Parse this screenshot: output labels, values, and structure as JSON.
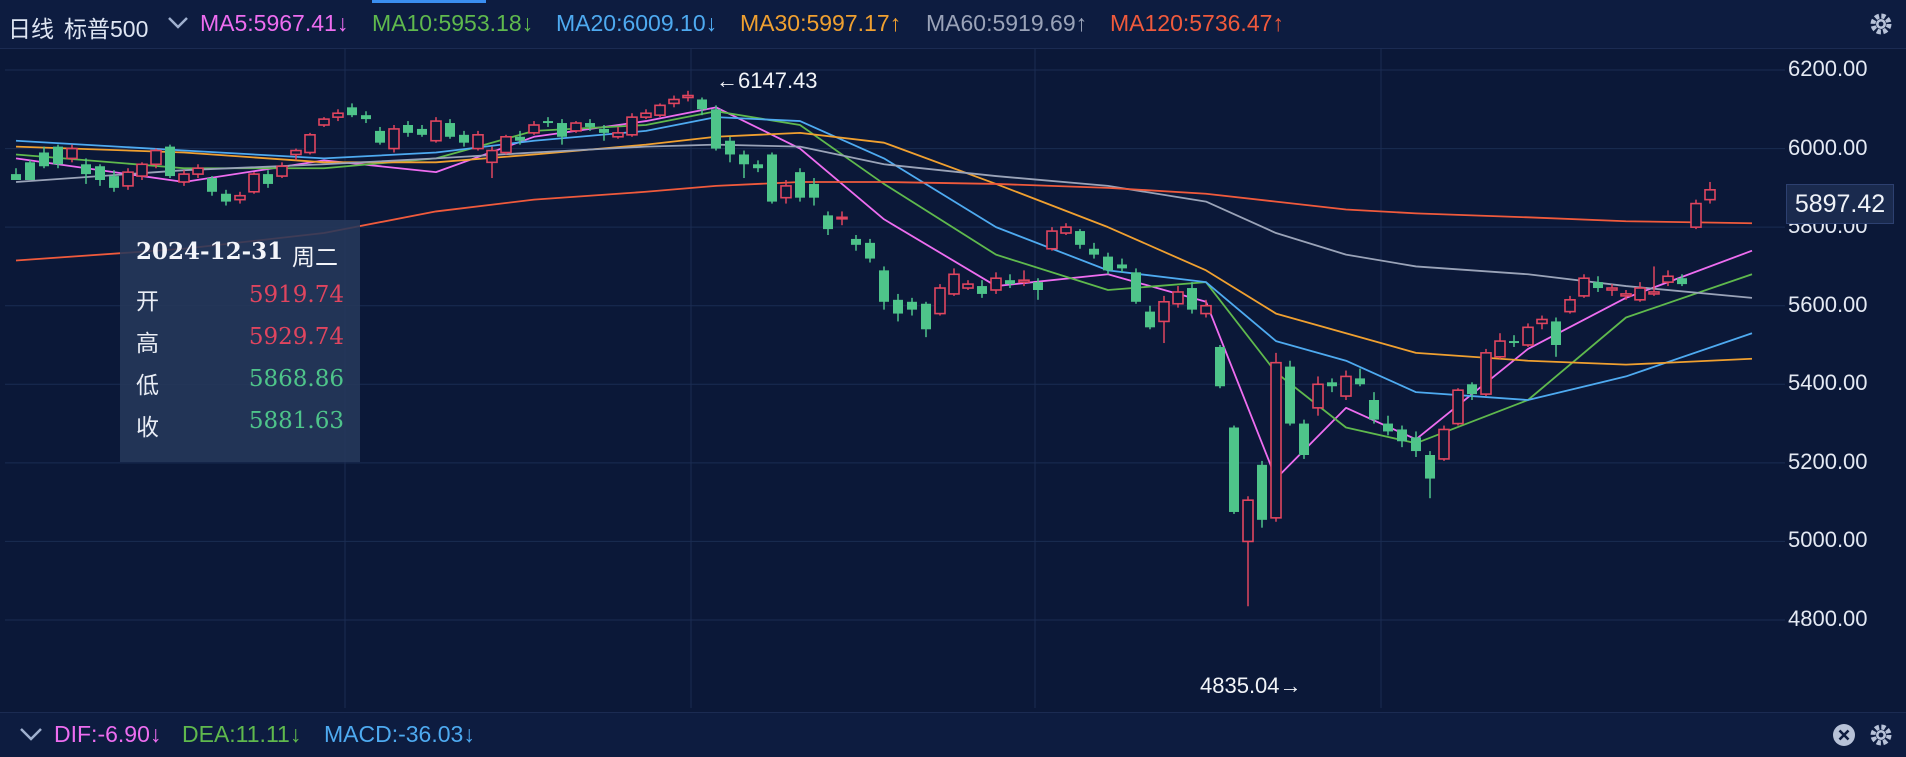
{
  "header": {
    "period": "日线",
    "symbol": "标普500",
    "ma_labels": [
      {
        "text": "MA5:5967.41",
        "arrow": "↓",
        "color": "#ee6df0"
      },
      {
        "text": "MA10:5953.18",
        "arrow": "↓",
        "color": "#5fb94d"
      },
      {
        "text": "MA20:6009.10",
        "arrow": "↓",
        "color": "#4eaaf0"
      },
      {
        "text": "MA30:5997.17",
        "arrow": "↑",
        "color": "#f0a030"
      },
      {
        "text": "MA60:5919.69",
        "arrow": "↑",
        "color": "#9aa3b8"
      },
      {
        "text": "MA120:5736.47",
        "arrow": "↑",
        "color": "#f05a3c"
      }
    ]
  },
  "tooltip": {
    "date": "2024-12-31",
    "weekday": "周二",
    "rows": [
      {
        "label": "开",
        "value": "5919.74",
        "color": "#e0455f"
      },
      {
        "label": "高",
        "value": "5929.74",
        "color": "#e0455f"
      },
      {
        "label": "低",
        "value": "5868.86",
        "color": "#4ec48a"
      },
      {
        "label": "收",
        "value": "5881.63",
        "color": "#4ec48a"
      }
    ]
  },
  "annotations": {
    "high": "←6147.43",
    "low": "4835.04→"
  },
  "current_price": "5897.42",
  "footer": {
    "macd": [
      {
        "text": "DIF:-6.90",
        "arrow": "↓",
        "color": "#ee6df0"
      },
      {
        "text": "DEA:11.11",
        "arrow": "↓",
        "color": "#5fb94d"
      },
      {
        "text": "MACD:-36.03",
        "arrow": "↓",
        "color": "#4eaaf0"
      }
    ]
  },
  "colors": {
    "up": "#e0455f",
    "down": "#4ec48a",
    "grid": "#1b2c52"
  },
  "chart_data": {
    "type": "candlestick",
    "y_ticks": [
      "6200.00",
      "6000.00",
      "5800.00",
      "5600.00",
      "5400.00",
      "5200.00",
      "5000.00",
      "4800.00"
    ],
    "ylim": [
      4780,
      6230
    ],
    "candles": [
      [
        5935,
        5920,
        5950,
        5925
      ],
      [
        5965,
        5920,
        5970,
        5940
      ],
      [
        5990,
        5955,
        6005,
        5950
      ],
      [
        6005,
        5960,
        6010,
        5950
      ],
      [
        5975,
        6000,
        6010,
        5965
      ],
      [
        5960,
        5935,
        5975,
        5910
      ],
      [
        5955,
        5920,
        5960,
        5905
      ],
      [
        5930,
        5900,
        5945,
        5890
      ],
      [
        5905,
        5940,
        5950,
        5895
      ],
      [
        5930,
        5960,
        5965,
        5920
      ],
      [
        5960,
        5995,
        6000,
        5950
      ],
      [
        6005,
        5930,
        6010,
        5925
      ],
      [
        5915,
        5935,
        5945,
        5905
      ],
      [
        5935,
        5950,
        5960,
        5925
      ],
      [
        5925,
        5890,
        5930,
        5880
      ],
      [
        5885,
        5865,
        5895,
        5855
      ],
      [
        5870,
        5880,
        5890,
        5860
      ],
      [
        5890,
        5935,
        5940,
        5885
      ],
      [
        5935,
        5910,
        5945,
        5900
      ],
      [
        5930,
        5955,
        5965,
        5925
      ],
      [
        5985,
        5995,
        6000,
        5970
      ],
      [
        5990,
        6035,
        6040,
        5985
      ],
      [
        6060,
        6075,
        6080,
        6055
      ],
      [
        6080,
        6090,
        6100,
        6070
      ],
      [
        6105,
        6085,
        6115,
        6080
      ],
      [
        6085,
        6075,
        6095,
        6065
      ],
      [
        6045,
        6015,
        6055,
        6010
      ],
      [
        6000,
        6050,
        6060,
        5990
      ],
      [
        6060,
        6040,
        6070,
        6030
      ],
      [
        6050,
        6035,
        6060,
        6030
      ],
      [
        6020,
        6070,
        6080,
        6015
      ],
      [
        6065,
        6030,
        6075,
        6025
      ],
      [
        6035,
        6015,
        6045,
        6005
      ],
      [
        6000,
        6035,
        6045,
        5995
      ],
      [
        5965,
        5995,
        6005,
        5925
      ],
      [
        5990,
        6030,
        6035,
        5985
      ],
      [
        6030,
        6020,
        6045,
        6010
      ],
      [
        6040,
        6060,
        6070,
        6035
      ],
      [
        6070,
        6065,
        6080,
        6055
      ],
      [
        6065,
        6030,
        6075,
        6010
      ],
      [
        6045,
        6065,
        6070,
        6040
      ],
      [
        6065,
        6055,
        6075,
        6045
      ],
      [
        6050,
        6040,
        6060,
        6020
      ],
      [
        6030,
        6040,
        6055,
        6025
      ],
      [
        6035,
        6080,
        6090,
        6030
      ],
      [
        6080,
        6090,
        6100,
        6075
      ],
      [
        6085,
        6110,
        6115,
        6080
      ],
      [
        6115,
        6125,
        6135,
        6105
      ],
      [
        6130,
        6135,
        6147,
        6120
      ],
      [
        6125,
        6100,
        6130,
        6085
      ],
      [
        6100,
        6000,
        6110,
        5995
      ],
      [
        6020,
        5985,
        6030,
        5965
      ],
      [
        5985,
        5960,
        5995,
        5925
      ],
      [
        5960,
        5950,
        5970,
        5940
      ],
      [
        5985,
        5865,
        5990,
        5860
      ],
      [
        5875,
        5905,
        5920,
        5860
      ],
      [
        5940,
        5875,
        5950,
        5865
      ],
      [
        5910,
        5875,
        5925,
        5855
      ],
      [
        5830,
        5795,
        5840,
        5780
      ],
      [
        5825,
        5825,
        5840,
        5805
      ],
      [
        5770,
        5755,
        5780,
        5740
      ],
      [
        5760,
        5720,
        5770,
        5710
      ],
      [
        5690,
        5610,
        5700,
        5590
      ],
      [
        5615,
        5580,
        5630,
        5560
      ],
      [
        5610,
        5590,
        5620,
        5575
      ],
      [
        5605,
        5540,
        5610,
        5520
      ],
      [
        5580,
        5645,
        5655,
        5575
      ],
      [
        5630,
        5680,
        5695,
        5625
      ],
      [
        5645,
        5655,
        5665,
        5640
      ],
      [
        5650,
        5630,
        5665,
        5620
      ],
      [
        5640,
        5670,
        5685,
        5630
      ],
      [
        5665,
        5655,
        5680,
        5645
      ],
      [
        5660,
        5665,
        5690,
        5650
      ],
      [
        5660,
        5640,
        5670,
        5615
      ],
      [
        5745,
        5790,
        5800,
        5740
      ],
      [
        5785,
        5800,
        5810,
        5780
      ],
      [
        5790,
        5755,
        5795,
        5745
      ],
      [
        5745,
        5730,
        5760,
        5720
      ],
      [
        5725,
        5690,
        5735,
        5680
      ],
      [
        5705,
        5695,
        5720,
        5685
      ],
      [
        5685,
        5610,
        5695,
        5605
      ],
      [
        5585,
        5545,
        5600,
        5540
      ],
      [
        5560,
        5610,
        5625,
        5505
      ],
      [
        5605,
        5635,
        5650,
        5595
      ],
      [
        5645,
        5590,
        5660,
        5580
      ],
      [
        5580,
        5600,
        5615,
        5570
      ],
      [
        5495,
        5395,
        5500,
        5390
      ],
      [
        5290,
        5075,
        5295,
        5070
      ],
      [
        5000,
        5105,
        5115,
        4835
      ],
      [
        5195,
        5055,
        5205,
        5035
      ],
      [
        5060,
        5455,
        5480,
        5050
      ],
      [
        5445,
        5300,
        5460,
        5295
      ],
      [
        5300,
        5220,
        5310,
        5210
      ],
      [
        5340,
        5400,
        5420,
        5320
      ],
      [
        5405,
        5395,
        5415,
        5380
      ],
      [
        5370,
        5420,
        5435,
        5360
      ],
      [
        5415,
        5400,
        5440,
        5395
      ],
      [
        5360,
        5310,
        5380,
        5300
      ],
      [
        5300,
        5280,
        5320,
        5270
      ],
      [
        5285,
        5255,
        5295,
        5240
      ],
      [
        5265,
        5230,
        5280,
        5215
      ],
      [
        5220,
        5160,
        5230,
        5110
      ],
      [
        5210,
        5285,
        5295,
        5205
      ],
      [
        5300,
        5385,
        5390,
        5295
      ],
      [
        5400,
        5375,
        5405,
        5360
      ],
      [
        5375,
        5480,
        5490,
        5370
      ],
      [
        5470,
        5510,
        5530,
        5465
      ],
      [
        5510,
        5505,
        5525,
        5495
      ],
      [
        5500,
        5545,
        5555,
        5495
      ],
      [
        5555,
        5565,
        5575,
        5540
      ],
      [
        5560,
        5500,
        5570,
        5470
      ],
      [
        5585,
        5615,
        5625,
        5580
      ],
      [
        5625,
        5670,
        5680,
        5620
      ],
      [
        5660,
        5645,
        5675,
        5635
      ],
      [
        5640,
        5645,
        5655,
        5625
      ],
      [
        5625,
        5630,
        5640,
        5615
      ],
      [
        5615,
        5645,
        5660,
        5610
      ],
      [
        5630,
        5635,
        5700,
        5625
      ],
      [
        5660,
        5675,
        5690,
        5650
      ],
      [
        5670,
        5655,
        5680,
        5650
      ],
      [
        5800,
        5860,
        5870,
        5795
      ],
      [
        5870,
        5895,
        5915,
        5860
      ]
    ],
    "ma": [
      {
        "name": "MA5",
        "color": "#ee6df0",
        "values": [
          [
            0,
            5975
          ],
          [
            12,
            5915
          ],
          [
            22,
            5970
          ],
          [
            30,
            5940
          ],
          [
            37,
            6030
          ],
          [
            45,
            6070
          ],
          [
            50,
            6105
          ],
          [
            56,
            6000
          ],
          [
            62,
            5820
          ],
          [
            70,
            5650
          ],
          [
            78,
            5680
          ],
          [
            85,
            5610
          ],
          [
            90,
            5160
          ],
          [
            95,
            5340
          ],
          [
            100,
            5260
          ],
          [
            108,
            5490
          ],
          [
            115,
            5620
          ],
          [
            124,
            5740
          ]
        ]
      },
      {
        "name": "MA10",
        "color": "#5fb94d",
        "values": [
          [
            0,
            5985
          ],
          [
            12,
            5950
          ],
          [
            22,
            5950
          ],
          [
            30,
            5975
          ],
          [
            37,
            6045
          ],
          [
            45,
            6060
          ],
          [
            50,
            6095
          ],
          [
            56,
            6060
          ],
          [
            62,
            5910
          ],
          [
            70,
            5730
          ],
          [
            78,
            5640
          ],
          [
            85,
            5660
          ],
          [
            90,
            5430
          ],
          [
            95,
            5290
          ],
          [
            100,
            5250
          ],
          [
            108,
            5360
          ],
          [
            115,
            5570
          ],
          [
            124,
            5680
          ]
        ]
      },
      {
        "name": "MA20",
        "color": "#4eaaf0",
        "values": [
          [
            0,
            6020
          ],
          [
            12,
            5995
          ],
          [
            22,
            5975
          ],
          [
            30,
            5990
          ],
          [
            37,
            6020
          ],
          [
            45,
            6045
          ],
          [
            50,
            6080
          ],
          [
            56,
            6070
          ],
          [
            62,
            5975
          ],
          [
            70,
            5800
          ],
          [
            78,
            5690
          ],
          [
            85,
            5660
          ],
          [
            90,
            5510
          ],
          [
            95,
            5460
          ],
          [
            100,
            5380
          ],
          [
            108,
            5360
          ],
          [
            115,
            5420
          ],
          [
            124,
            5530
          ]
        ]
      },
      {
        "name": "MA30",
        "color": "#f0a030",
        "values": [
          [
            0,
            6005
          ],
          [
            12,
            5990
          ],
          [
            22,
            5965
          ],
          [
            30,
            5965
          ],
          [
            37,
            5985
          ],
          [
            45,
            6010
          ],
          [
            50,
            6030
          ],
          [
            56,
            6040
          ],
          [
            62,
            6015
          ],
          [
            70,
            5910
          ],
          [
            78,
            5800
          ],
          [
            85,
            5690
          ],
          [
            90,
            5580
          ],
          [
            95,
            5530
          ],
          [
            100,
            5480
          ],
          [
            108,
            5460
          ],
          [
            115,
            5450
          ],
          [
            124,
            5465
          ]
        ]
      },
      {
        "name": "MA60",
        "color": "#9aa3b8",
        "values": [
          [
            0,
            5915
          ],
          [
            12,
            5945
          ],
          [
            22,
            5960
          ],
          [
            30,
            5975
          ],
          [
            37,
            5990
          ],
          [
            45,
            6005
          ],
          [
            50,
            6010
          ],
          [
            56,
            6005
          ],
          [
            62,
            5960
          ],
          [
            70,
            5930
          ],
          [
            78,
            5905
          ],
          [
            85,
            5865
          ],
          [
            90,
            5785
          ],
          [
            95,
            5730
          ],
          [
            100,
            5700
          ],
          [
            108,
            5680
          ],
          [
            115,
            5650
          ],
          [
            124,
            5620
          ]
        ]
      },
      {
        "name": "MA120",
        "color": "#f05a3c",
        "values": [
          [
            0,
            5715
          ],
          [
            12,
            5745
          ],
          [
            22,
            5785
          ],
          [
            30,
            5840
          ],
          [
            37,
            5870
          ],
          [
            45,
            5890
          ],
          [
            50,
            5905
          ],
          [
            56,
            5915
          ],
          [
            62,
            5915
          ],
          [
            70,
            5910
          ],
          [
            78,
            5900
          ],
          [
            85,
            5885
          ],
          [
            90,
            5865
          ],
          [
            95,
            5845
          ],
          [
            100,
            5835
          ],
          [
            108,
            5825
          ],
          [
            115,
            5815
          ],
          [
            124,
            5810
          ]
        ]
      }
    ]
  }
}
